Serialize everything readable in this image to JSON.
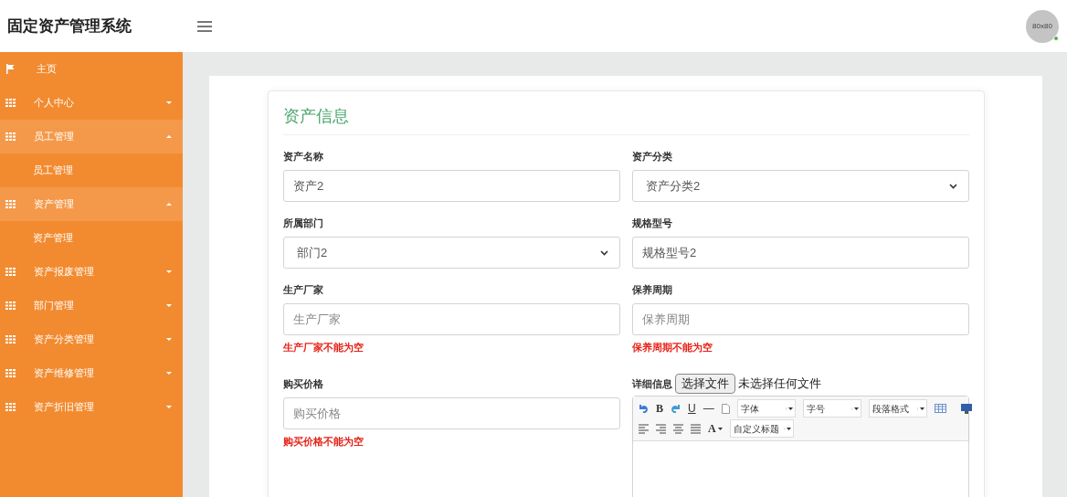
{
  "header": {
    "title": "固定资产管理系统",
    "avatar": "80x80",
    "online": true
  },
  "sidebar": {
    "items": [
      {
        "kind": "link",
        "label": "主页"
      },
      {
        "kind": "group",
        "label": "个人中心",
        "expanded": false
      },
      {
        "kind": "group",
        "label": "员工管理",
        "expanded": true,
        "children": [
          {
            "label": "员工管理"
          }
        ]
      },
      {
        "kind": "group",
        "label": "资产管理",
        "expanded": true,
        "children": [
          {
            "label": "资产管理"
          }
        ]
      },
      {
        "kind": "group",
        "label": "资产报废管理",
        "expanded": false
      },
      {
        "kind": "group",
        "label": "部门管理",
        "expanded": false
      },
      {
        "kind": "group",
        "label": "资产分类管理",
        "expanded": false
      },
      {
        "kind": "group",
        "label": "资产维修管理",
        "expanded": false
      },
      {
        "kind": "group",
        "label": "资产折旧管理",
        "expanded": false
      }
    ]
  },
  "form": {
    "title": "资产信息",
    "fields": [
      {
        "kind": "text",
        "label": "资产名称",
        "value": "资产2"
      },
      {
        "kind": "select",
        "label": "资产分类",
        "value": "资产分类2"
      },
      {
        "kind": "select",
        "label": "所属部门",
        "value": "部门2"
      },
      {
        "kind": "text",
        "label": "规格型号",
        "value": "规格型号2"
      },
      {
        "kind": "text",
        "label": "生产厂家",
        "placeholder": "生产厂家",
        "error": "生产厂家不能为空"
      },
      {
        "kind": "text",
        "label": "保养周期",
        "placeholder": "保养周期",
        "error": "保养周期不能为空"
      },
      {
        "kind": "text",
        "label": "购买价格",
        "placeholder": "购买价格",
        "error": "购买价格不能为空"
      },
      {
        "kind": "editor",
        "label": "详细信息",
        "file_button": "选择文件",
        "file_status": "未选择任何文件",
        "toolbar": {
          "bold": "B",
          "underline": "U",
          "rule": "—",
          "font": "字体",
          "size": "字号",
          "paragraph": "段落格式",
          "font_color": "A",
          "heading": "自定义标题"
        }
      }
    ]
  }
}
